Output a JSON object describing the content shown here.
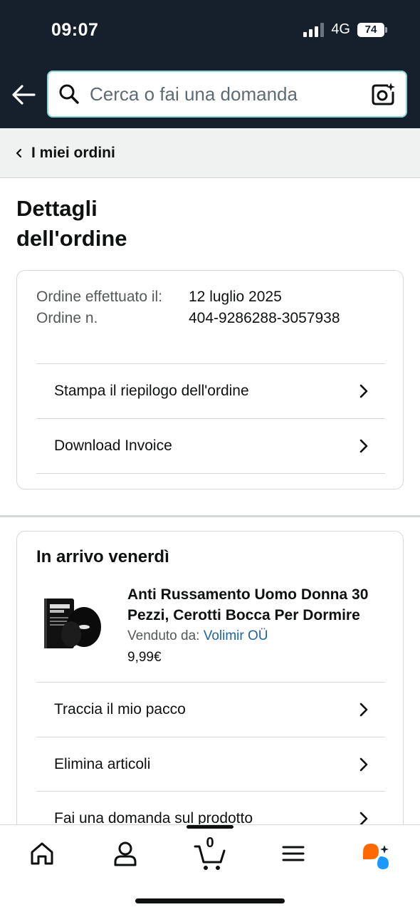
{
  "status_bar": {
    "time": "09:07",
    "network": "4G",
    "battery": "74"
  },
  "search": {
    "placeholder": "Cerca o fai una domanda"
  },
  "breadcrumb": {
    "label": "I miei ordini"
  },
  "page": {
    "title": "Dettagli dell'ordine"
  },
  "order": {
    "placed_label": "Ordine effettuato il:",
    "number_label": "Ordine n.",
    "placed_value": "12 luglio 2025",
    "number_value": "404-9286288-3057938"
  },
  "order_actions": [
    {
      "label": "Stampa il riepilogo dell'ordine"
    },
    {
      "label": "Download Invoice"
    }
  ],
  "shipment": {
    "heading": "In arrivo venerdì",
    "product_title": "Anti Russamento Uomo Donna 30 Pezzi, Cerotti Bocca Per Dormire",
    "sold_by_label": "Venduto da:",
    "seller": "Volimir OÜ",
    "price": "9,99€"
  },
  "shipment_actions": [
    {
      "label": "Traccia il mio pacco"
    },
    {
      "label": "Elimina articoli"
    },
    {
      "label": "Fai una domanda sul prodotto"
    }
  ],
  "bottom_nav": {
    "cart_count": "0"
  },
  "colors": {
    "header": "#16202c",
    "link": "#2162a1",
    "search_border": "#8ad4dc",
    "accent": "#ff6a00"
  }
}
